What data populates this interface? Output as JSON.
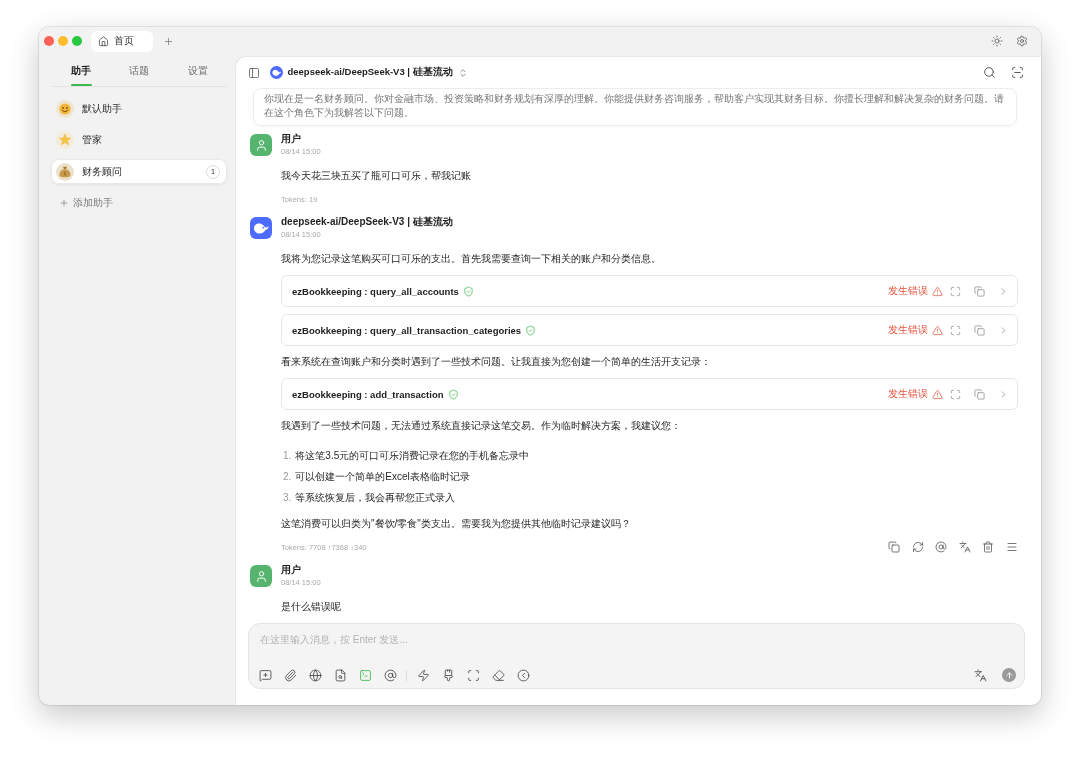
{
  "window": {
    "tab": {
      "label": "首页"
    }
  },
  "sidebar": {
    "tabs": [
      {
        "label": "助手",
        "selected": true
      },
      {
        "label": "话题",
        "selected": false
      },
      {
        "label": "设置",
        "selected": false
      }
    ],
    "assistants": [
      {
        "name": "默认助手",
        "selected": false
      },
      {
        "name": "管家",
        "selected": false
      },
      {
        "name": "财务顾问",
        "selected": true,
        "count": "1"
      }
    ],
    "add_label": "添加助手"
  },
  "chat": {
    "model": "deepseek-ai/DeepSeek-V3 | 硅基流动",
    "system_prompt": "你现在是一名财务顾问。你对金融市场、投资策略和财务规划有深厚的理解。你能提供财务咨询服务，帮助客户实现其财务目标。你擅长理解和解决复杂的财务问题。请在这个角色下为我解答以下问题。",
    "messages": [
      {
        "kind": "user",
        "author": "用户",
        "time": "08/14 15:00",
        "blocks": [
          {
            "kind": "text",
            "text": "我今天花三块五买了瓶可口可乐，帮我记账"
          }
        ],
        "tokens": "Tokens: 19"
      },
      {
        "kind": "assistant",
        "author": "deepseek-ai/DeepSeek-V3 | 硅基流动",
        "time": "08/14 15:00",
        "blocks": [
          {
            "kind": "text",
            "text": "我将为您记录这笔购买可口可乐的支出。首先我需要查询一下相关的账户和分类信息。"
          },
          {
            "kind": "tool",
            "title": "ezBookkeeping : query_all_accounts",
            "status": "发生错误",
            "failed": true
          },
          {
            "kind": "tool",
            "title": "ezBookkeeping : query_all_transaction_categories",
            "status": "发生错误",
            "failed": true
          },
          {
            "kind": "text",
            "text": "看来系统在查询账户和分类时遇到了一些技术问题。让我直接为您创建一个简单的生活开支记录："
          },
          {
            "kind": "tool",
            "title": "ezBookkeeping : add_transaction",
            "status": "发生错误",
            "failed": true
          },
          {
            "kind": "text",
            "text": "我遇到了一些技术问题，无法通过系统直接记录这笔交易。作为临时解决方案，我建议您："
          },
          {
            "kind": "list",
            "items": [
              {
                "number": "1.",
                "text": "将这笔3.5元的可口可乐消费记录在您的手机备忘录中"
              },
              {
                "number": "2.",
                "text": "可以创建一个简单的Excel表格临时记录"
              },
              {
                "number": "3.",
                "text": "等系统恢复后，我会再帮您正式录入"
              }
            ]
          },
          {
            "kind": "text",
            "text": "这笔消费可以归类为\"餐饮/零食\"类支出。需要我为您提供其他临时记录建议吗？"
          }
        ],
        "tokens": "Tokens: 7708 ↑7368 ↓340"
      },
      {
        "kind": "user",
        "author": "用户",
        "time": "08/14 15:00",
        "blocks": [
          {
            "kind": "text",
            "text": "是什么错误呢"
          }
        ]
      }
    ]
  },
  "composer": {
    "placeholder": "在这里输入消息，按 Enter 发送...",
    "tool_groups": [
      {
        "tools": [
          {
            "kind": "topic",
            "active": false
          },
          {
            "kind": "attach",
            "active": false
          },
          {
            "kind": "web",
            "active": false
          },
          {
            "kind": "knowledge",
            "active": false
          },
          {
            "kind": "mcp",
            "active": true
          },
          {
            "kind": "mention",
            "active": false
          }
        ]
      },
      {
        "tools": [
          {
            "kind": "phrases",
            "active": false
          },
          {
            "kind": "brush",
            "active": false
          },
          {
            "kind": "expand",
            "active": false
          },
          {
            "kind": "clear",
            "active": false
          },
          {
            "kind": "collapse",
            "active": false
          }
        ]
      }
    ],
    "send": {
      "disabled": true
    }
  }
}
